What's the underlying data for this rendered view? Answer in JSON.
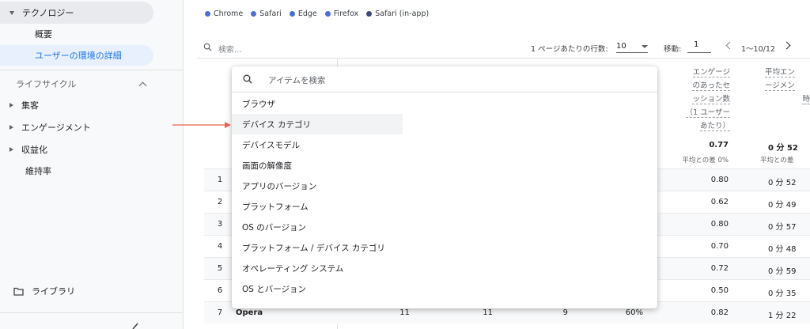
{
  "sidebar": {
    "section_technology": "テクノロジー",
    "item_overview": "概要",
    "item_user_env": "ユーザーの環境の詳細",
    "lifecycle_header": "ライフサイクル",
    "lifecycle_items": [
      "集客",
      "エンゲージメント",
      "収益化"
    ],
    "retention": "維持率",
    "library": "ライブラリ"
  },
  "legend": {
    "items": [
      "Chrome",
      "Safari",
      "Edge",
      "Firefox",
      "Safari (in-app)"
    ],
    "colors": [
      "#4a6fd1",
      "#4a6fd1",
      "#4a6fd1",
      "#4a6fd1",
      "#3c4a78"
    ]
  },
  "toolbar": {
    "search_placeholder": "検索...",
    "rows_per_page_label": "1 ページあたりの行数:",
    "rows_per_page_value": "10",
    "goto_label": "移動:",
    "goto_value": "1",
    "page_range": "1〜10/12"
  },
  "table": {
    "col1_header": [
      "エンゲージ",
      "のあったセ",
      "ッション数",
      "（1 ユーザー",
      "あたり）"
    ],
    "col2_header": [
      "平均エン",
      "ージメン",
      "時"
    ],
    "col1_total": "0.77",
    "col1_total_sub": "平均との差 0%",
    "col2_total": "0 分 52",
    "col2_total_sub": "平均との差",
    "rows": [
      {
        "n": "1",
        "v1": "0.80",
        "v2": "0 分 52"
      },
      {
        "n": "2",
        "v1": "0.62",
        "v2": "0 分 49"
      },
      {
        "n": "3",
        "v1": "0.80",
        "v2": "0 分 57"
      },
      {
        "n": "4",
        "v1": "0.70",
        "v2": "0 分 48"
      },
      {
        "n": "5",
        "v1": "0.72",
        "v2": "0 分 59"
      },
      {
        "n": "6",
        "v1": "0.50",
        "v2": "0 分 35"
      },
      {
        "n": "7",
        "dim": "Opera",
        "a": "11",
        "b": "11",
        "c": "9",
        "pct": "60%",
        "v1": "0.82",
        "v2": "1 分 22"
      }
    ]
  },
  "dropdown": {
    "search_placeholder": "アイテムを検索",
    "items": [
      "ブラウザ",
      "デバイス カテゴリ",
      "デバイスモデル",
      "画面の解像度",
      "アプリのバージョン",
      "プラットフォーム",
      "OS のバージョン",
      "プラットフォーム / デバイス カテゴリ",
      "オペレーティング システム",
      "OS とバージョン"
    ],
    "hovered_index": 1
  },
  "accent_color": "#1a73e8",
  "arrow_color": "#e8654f"
}
